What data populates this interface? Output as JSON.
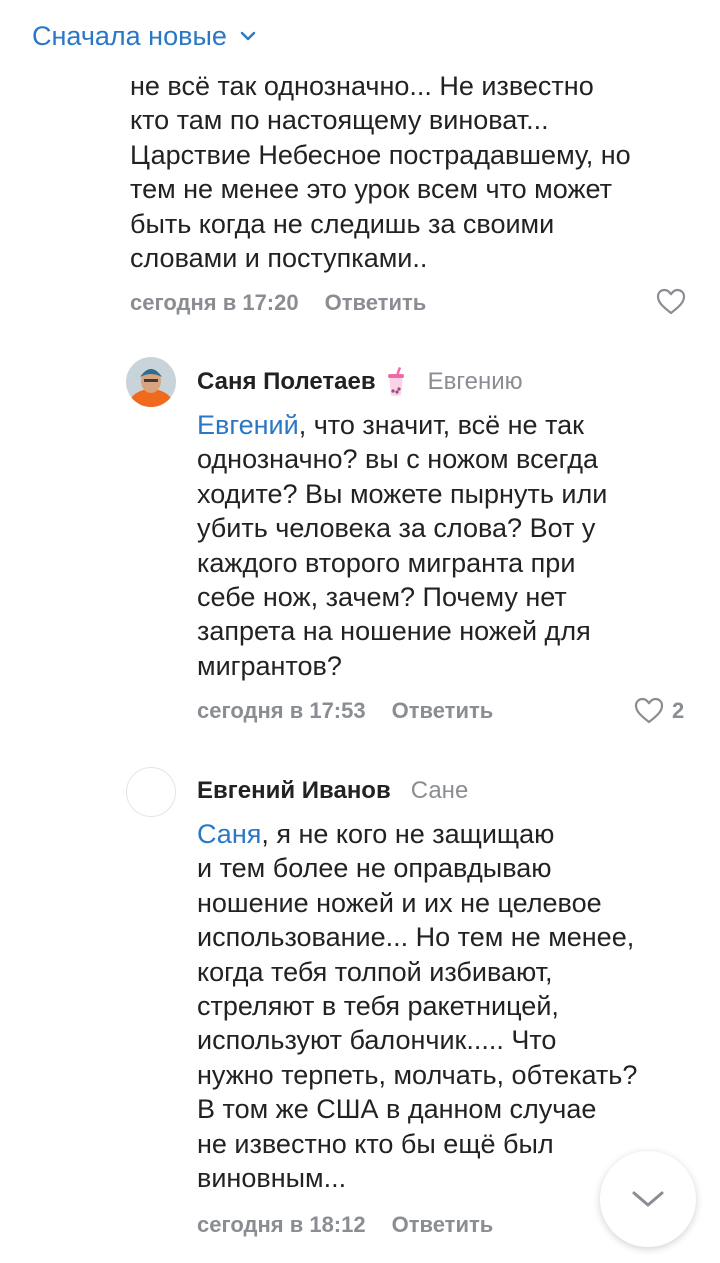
{
  "sort": {
    "label": "Сначала новые"
  },
  "comment1": {
    "text": "не всё так однозначно... Не известно\nкто там по настоящему виноват...\nЦарствие Небесное пострадавшему, но\nтем не менее это урок всем что может\nбыть когда не следишь за своими\nсловами и поступками..",
    "time": "сегодня в 17:20",
    "reply_label": "Ответить"
  },
  "comment2": {
    "author": "Саня Полетаев",
    "reply_to": "Евгению",
    "mention": "Евгений",
    "text": ", что значит, всё не так\nоднозначно? вы с ножом всегда\nходите? Вы можете пырнуть или\nубить человека за слова? Вот у\nкаждого второго мигранта при\nсебе нож, зачем? Почему нет\nзапрета на ношение ножей для\nмигрантов?",
    "time": "сегодня в 17:53",
    "reply_label": "Ответить",
    "likes": "2"
  },
  "comment3": {
    "author": "Евгений Иванов",
    "reply_to": "Сане",
    "mention": "Саня",
    "text": ", я не кого не защищаю\nи тем более не оправдываю\nношение ножей и их не целевое\nиспользование... Но тем не менее,\nкогда тебя толпой избивают,\nстреляют в тебя ракетницей,\nиспользуют балончик..... Что\nнужно терпеть, молчать, обтекать?\nВ том же США в данном случае\nне известно кто бы ещё был\nвиновным...",
    "time": "сегодня в 18:12",
    "reply_label": "Ответить"
  },
  "icons": {
    "sort": "chevron-down-icon",
    "like": "heart-outline-icon",
    "scroll": "chevron-down-icon",
    "emoji": "bubble-tea-emoji"
  },
  "colors": {
    "accent": "#2a77c6",
    "text": "#222222",
    "muted": "#8a8d92"
  }
}
